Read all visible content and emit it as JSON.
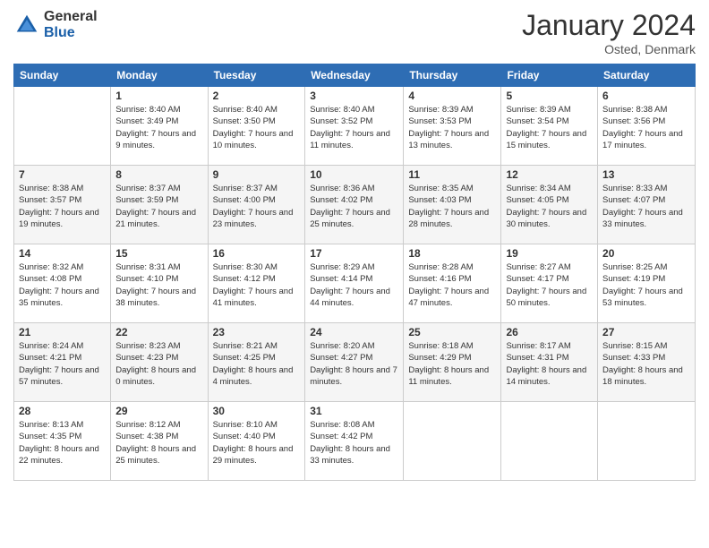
{
  "logo": {
    "general": "General",
    "blue": "Blue"
  },
  "title": "January 2024",
  "location": "Osted, Denmark",
  "days_of_week": [
    "Sunday",
    "Monday",
    "Tuesday",
    "Wednesday",
    "Thursday",
    "Friday",
    "Saturday"
  ],
  "weeks": [
    [
      {
        "day": "",
        "sunrise": "",
        "sunset": "",
        "daylight": ""
      },
      {
        "day": "1",
        "sunrise": "Sunrise: 8:40 AM",
        "sunset": "Sunset: 3:49 PM",
        "daylight": "Daylight: 7 hours and 9 minutes."
      },
      {
        "day": "2",
        "sunrise": "Sunrise: 8:40 AM",
        "sunset": "Sunset: 3:50 PM",
        "daylight": "Daylight: 7 hours and 10 minutes."
      },
      {
        "day": "3",
        "sunrise": "Sunrise: 8:40 AM",
        "sunset": "Sunset: 3:52 PM",
        "daylight": "Daylight: 7 hours and 11 minutes."
      },
      {
        "day": "4",
        "sunrise": "Sunrise: 8:39 AM",
        "sunset": "Sunset: 3:53 PM",
        "daylight": "Daylight: 7 hours and 13 minutes."
      },
      {
        "day": "5",
        "sunrise": "Sunrise: 8:39 AM",
        "sunset": "Sunset: 3:54 PM",
        "daylight": "Daylight: 7 hours and 15 minutes."
      },
      {
        "day": "6",
        "sunrise": "Sunrise: 8:38 AM",
        "sunset": "Sunset: 3:56 PM",
        "daylight": "Daylight: 7 hours and 17 minutes."
      }
    ],
    [
      {
        "day": "7",
        "sunrise": "Sunrise: 8:38 AM",
        "sunset": "Sunset: 3:57 PM",
        "daylight": "Daylight: 7 hours and 19 minutes."
      },
      {
        "day": "8",
        "sunrise": "Sunrise: 8:37 AM",
        "sunset": "Sunset: 3:59 PM",
        "daylight": "Daylight: 7 hours and 21 minutes."
      },
      {
        "day": "9",
        "sunrise": "Sunrise: 8:37 AM",
        "sunset": "Sunset: 4:00 PM",
        "daylight": "Daylight: 7 hours and 23 minutes."
      },
      {
        "day": "10",
        "sunrise": "Sunrise: 8:36 AM",
        "sunset": "Sunset: 4:02 PM",
        "daylight": "Daylight: 7 hours and 25 minutes."
      },
      {
        "day": "11",
        "sunrise": "Sunrise: 8:35 AM",
        "sunset": "Sunset: 4:03 PM",
        "daylight": "Daylight: 7 hours and 28 minutes."
      },
      {
        "day": "12",
        "sunrise": "Sunrise: 8:34 AM",
        "sunset": "Sunset: 4:05 PM",
        "daylight": "Daylight: 7 hours and 30 minutes."
      },
      {
        "day": "13",
        "sunrise": "Sunrise: 8:33 AM",
        "sunset": "Sunset: 4:07 PM",
        "daylight": "Daylight: 7 hours and 33 minutes."
      }
    ],
    [
      {
        "day": "14",
        "sunrise": "Sunrise: 8:32 AM",
        "sunset": "Sunset: 4:08 PM",
        "daylight": "Daylight: 7 hours and 35 minutes."
      },
      {
        "day": "15",
        "sunrise": "Sunrise: 8:31 AM",
        "sunset": "Sunset: 4:10 PM",
        "daylight": "Daylight: 7 hours and 38 minutes."
      },
      {
        "day": "16",
        "sunrise": "Sunrise: 8:30 AM",
        "sunset": "Sunset: 4:12 PM",
        "daylight": "Daylight: 7 hours and 41 minutes."
      },
      {
        "day": "17",
        "sunrise": "Sunrise: 8:29 AM",
        "sunset": "Sunset: 4:14 PM",
        "daylight": "Daylight: 7 hours and 44 minutes."
      },
      {
        "day": "18",
        "sunrise": "Sunrise: 8:28 AM",
        "sunset": "Sunset: 4:16 PM",
        "daylight": "Daylight: 7 hours and 47 minutes."
      },
      {
        "day": "19",
        "sunrise": "Sunrise: 8:27 AM",
        "sunset": "Sunset: 4:17 PM",
        "daylight": "Daylight: 7 hours and 50 minutes."
      },
      {
        "day": "20",
        "sunrise": "Sunrise: 8:25 AM",
        "sunset": "Sunset: 4:19 PM",
        "daylight": "Daylight: 7 hours and 53 minutes."
      }
    ],
    [
      {
        "day": "21",
        "sunrise": "Sunrise: 8:24 AM",
        "sunset": "Sunset: 4:21 PM",
        "daylight": "Daylight: 7 hours and 57 minutes."
      },
      {
        "day": "22",
        "sunrise": "Sunrise: 8:23 AM",
        "sunset": "Sunset: 4:23 PM",
        "daylight": "Daylight: 8 hours and 0 minutes."
      },
      {
        "day": "23",
        "sunrise": "Sunrise: 8:21 AM",
        "sunset": "Sunset: 4:25 PM",
        "daylight": "Daylight: 8 hours and 4 minutes."
      },
      {
        "day": "24",
        "sunrise": "Sunrise: 8:20 AM",
        "sunset": "Sunset: 4:27 PM",
        "daylight": "Daylight: 8 hours and 7 minutes."
      },
      {
        "day": "25",
        "sunrise": "Sunrise: 8:18 AM",
        "sunset": "Sunset: 4:29 PM",
        "daylight": "Daylight: 8 hours and 11 minutes."
      },
      {
        "day": "26",
        "sunrise": "Sunrise: 8:17 AM",
        "sunset": "Sunset: 4:31 PM",
        "daylight": "Daylight: 8 hours and 14 minutes."
      },
      {
        "day": "27",
        "sunrise": "Sunrise: 8:15 AM",
        "sunset": "Sunset: 4:33 PM",
        "daylight": "Daylight: 8 hours and 18 minutes."
      }
    ],
    [
      {
        "day": "28",
        "sunrise": "Sunrise: 8:13 AM",
        "sunset": "Sunset: 4:35 PM",
        "daylight": "Daylight: 8 hours and 22 minutes."
      },
      {
        "day": "29",
        "sunrise": "Sunrise: 8:12 AM",
        "sunset": "Sunset: 4:38 PM",
        "daylight": "Daylight: 8 hours and 25 minutes."
      },
      {
        "day": "30",
        "sunrise": "Sunrise: 8:10 AM",
        "sunset": "Sunset: 4:40 PM",
        "daylight": "Daylight: 8 hours and 29 minutes."
      },
      {
        "day": "31",
        "sunrise": "Sunrise: 8:08 AM",
        "sunset": "Sunset: 4:42 PM",
        "daylight": "Daylight: 8 hours and 33 minutes."
      },
      {
        "day": "",
        "sunrise": "",
        "sunset": "",
        "daylight": ""
      },
      {
        "day": "",
        "sunrise": "",
        "sunset": "",
        "daylight": ""
      },
      {
        "day": "",
        "sunrise": "",
        "sunset": "",
        "daylight": ""
      }
    ]
  ]
}
